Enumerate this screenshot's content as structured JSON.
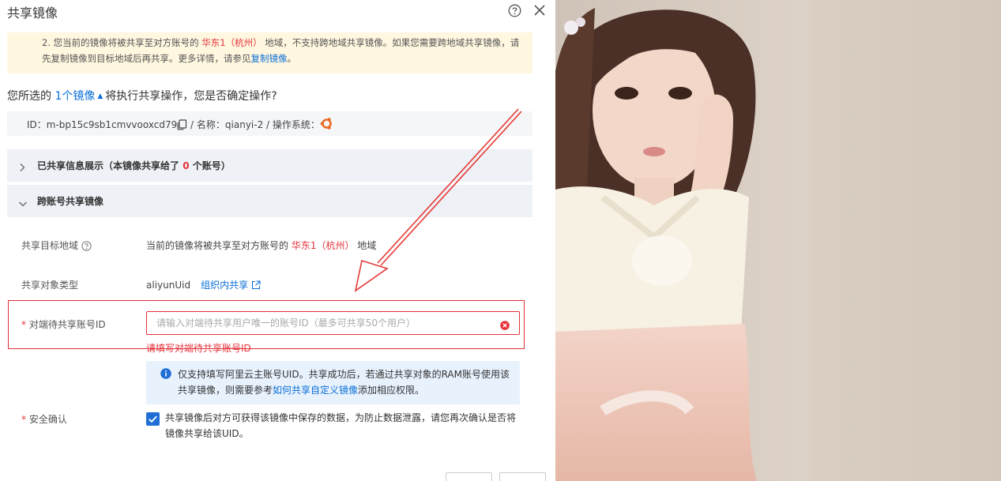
{
  "dialog": {
    "title": "共享镜像",
    "notice": {
      "part1": "2. 您当前的镜像将被共享至对方账号的 ",
      "region": "华东1（杭州）",
      "part2": " 地域，不支持跨地域共享镜像。如果您需要跨地域共享镜像，请先复制镜像到目标地域后再共享。更多详情，请参见",
      "link": "复制镜像",
      "part3": "。"
    },
    "confirm": {
      "prefix": "您所选的 ",
      "count_link": "1个镜像",
      "suffix": "将执行共享操作，您是否确定操作?"
    },
    "image_info": {
      "id_text": "ID：m-bp15c9sb1cmvvooxcd79",
      "rest": " / 名称：qianyi-2 / 操作系统："
    },
    "panel_shared": {
      "title_prefix": "已共享信息展示（本镜像共享给了 ",
      "count": "0",
      "title_suffix": " 个账号）"
    },
    "panel_cross": {
      "title": "跨账号共享镜像"
    },
    "fields": {
      "region_label": "共享目标地域",
      "region_prefix": "当前的镜像将被共享至对方账号的 ",
      "region_value": "华东1（杭州）",
      "region_suffix": " 地域",
      "type_label": "共享对象类型",
      "type_value": "aliyunUid",
      "type_link": "组织内共享",
      "account_label": "对端待共享账号ID",
      "account_value": "",
      "account_placeholder": "请输入对端待共享用户唯一的账号ID（最多可共享50个用户）",
      "account_error": "请填写对端待共享账号ID",
      "tip_prefix": "仅支持填写阿里云主账号UID。共享成功后，若通过共享对象的RAM账号使用该共享镜像，则需要参考",
      "tip_link": "如何共享自定义镜像",
      "tip_suffix": "添加相应权限。",
      "security_label": "安全确认",
      "security_text": "共享镜像后对方可获得该镜像中保存的数据，为防止数据泄露，请您再次确认是否将镜像共享给该UID。",
      "security_checked": true
    },
    "footer": {
      "ok_label": "",
      "cancel_label": ""
    },
    "colors": {
      "accent": "#1f6fd6",
      "error": "#e5323a",
      "notice_bg": "#fff7e0",
      "tip_bg": "#e8f2fd",
      "panel_bg": "#eef1f6"
    }
  },
  "photo": {
    "subject": "portrait-photo"
  }
}
